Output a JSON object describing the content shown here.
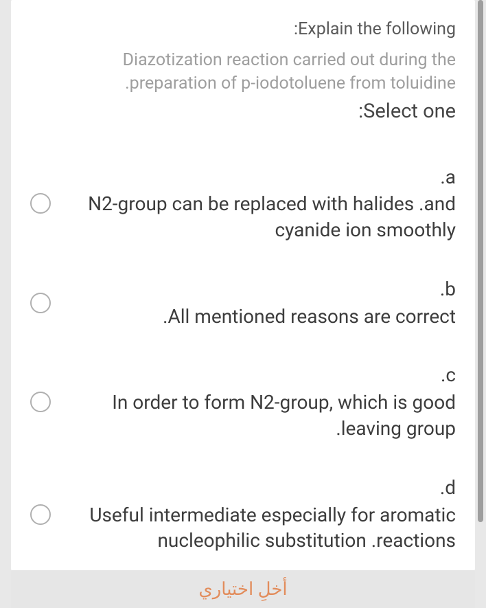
{
  "question": {
    "title": ":Explain the following",
    "subtitle": "Diazotization reaction carried out during the .preparation of p-iodotoluene from toluidine",
    "select_label": ":Select one"
  },
  "options": [
    {
      "letter": ".a",
      "text": "N2-group can be replaced with halides .and cyanide ion smoothly"
    },
    {
      "letter": ".b",
      "text": ".All mentioned reasons are correct"
    },
    {
      "letter": ".c",
      "text": "In order to form N2-group, which is good .leaving group"
    },
    {
      "letter": ".d",
      "text": "Useful intermediate especially for aromatic nucleophilic substitution .reactions"
    }
  ],
  "footer": {
    "clear_label": "أخلِ اختياري"
  }
}
